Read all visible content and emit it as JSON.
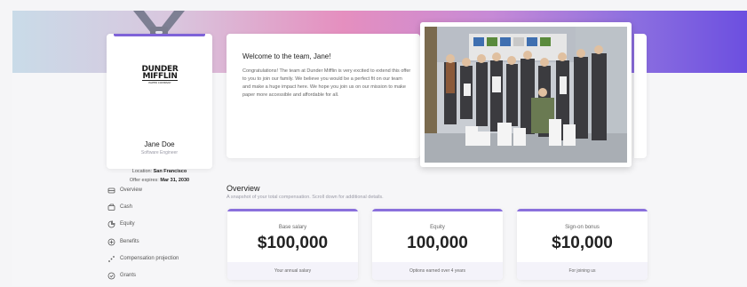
{
  "colors": {
    "accent": "#7e62d8",
    "hero_gradient_start": "#c9dbe8",
    "hero_gradient_end": "#6c4fe0",
    "card_footer_bg": "#f4f3fa"
  },
  "profile": {
    "logo_line1": "DUNDER",
    "logo_line2": "MIFFLIN",
    "logo_line3": "PAPER COMPANY",
    "name": "Jane Doe",
    "role": "Software Engineer",
    "location_label": "Location:",
    "location_value": "San Francisco",
    "expires_label": "Offer expires:",
    "expires_value": "Mar 31, 2030"
  },
  "welcome": {
    "title": "Welcome to the team, Jane!",
    "body": "Congratulations! The team at Dunder Mifflin is very excited to extend this offer to you to join our family. We believe you would be a perfect fit on our team and make a huge impact here. We hope you join us on our mission to make paper more accessible and affordable for all."
  },
  "sidebar": {
    "items": [
      {
        "label": "Overview",
        "icon": "overview-icon"
      },
      {
        "label": "Cash",
        "icon": "cash-icon"
      },
      {
        "label": "Equity",
        "icon": "equity-icon"
      },
      {
        "label": "Benefits",
        "icon": "benefits-icon"
      },
      {
        "label": "Compensation projection",
        "icon": "projection-icon"
      },
      {
        "label": "Grants",
        "icon": "grants-icon"
      }
    ]
  },
  "overview": {
    "title": "Overview",
    "subtitle": "A snapshot of your total compensation. Scroll down for additional details."
  },
  "stats": [
    {
      "label": "Base salary",
      "value": "$100,000",
      "footer": "Your annual salary"
    },
    {
      "label": "Equity",
      "value": "100,000",
      "footer": "Options earned over 4 years"
    },
    {
      "label": "Sign-on bonus",
      "value": "$10,000",
      "footer": "For joining us"
    }
  ]
}
